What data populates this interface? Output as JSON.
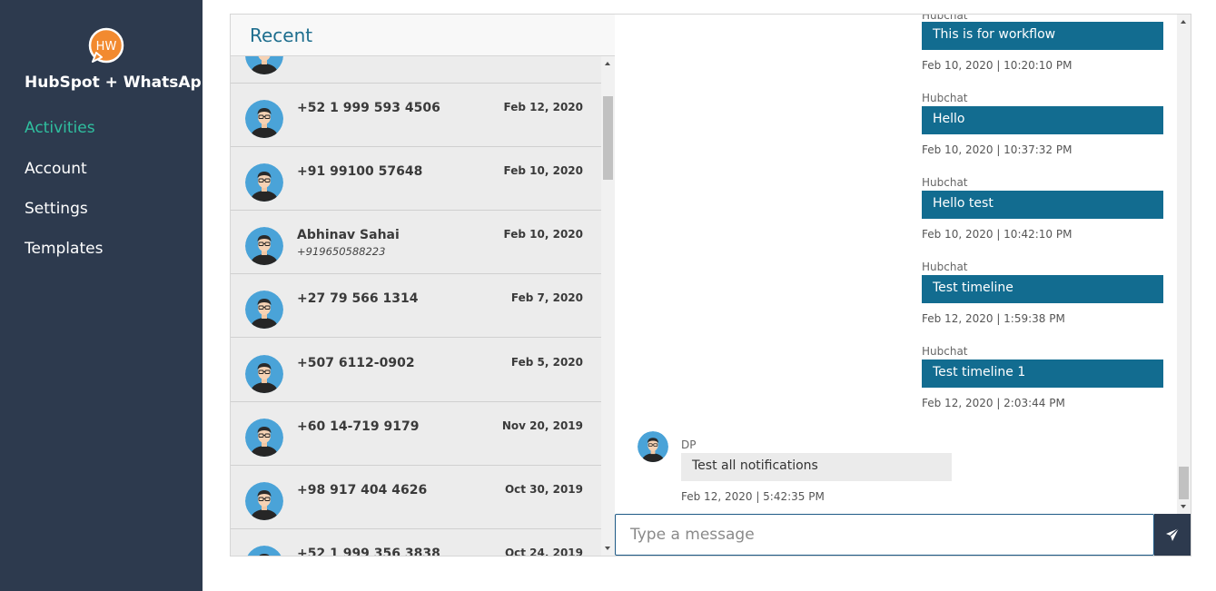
{
  "brand": {
    "logo_text": "HW",
    "name": "HubSpot + WhatsApp",
    "accent": "#2fbf9f",
    "logo_color": "#f28a30"
  },
  "nav": [
    {
      "label": "Activities",
      "active": true
    },
    {
      "label": "Account",
      "active": false
    },
    {
      "label": "Settings",
      "active": false
    },
    {
      "label": "Templates",
      "active": false
    }
  ],
  "recent": {
    "title": "Recent",
    "contacts": [
      {
        "name": "+52 1 999 593 4506",
        "sub": "",
        "date": "Feb 12, 2020"
      },
      {
        "name": "+91 99100 57648",
        "sub": "",
        "date": "Feb 10, 2020"
      },
      {
        "name": "Abhinav Sahai",
        "sub": "+919650588223",
        "date": "Feb 10, 2020"
      },
      {
        "name": "+27 79 566 1314",
        "sub": "",
        "date": "Feb 7, 2020"
      },
      {
        "name": "+507 6112-0902",
        "sub": "",
        "date": "Feb 5, 2020"
      },
      {
        "name": "+60 14-719 9179",
        "sub": "",
        "date": "Nov 20, 2019"
      },
      {
        "name": "+98 917 404 4626",
        "sub": "",
        "date": "Oct 30, 2019"
      },
      {
        "name": "+52 1 999 356 3838",
        "sub": "",
        "date": "Oct 24, 2019"
      }
    ]
  },
  "chat": {
    "messages": [
      {
        "sender": "Hubchat",
        "text": "This is for workflow",
        "time": "Feb 10, 2020 | 10:20:10 PM"
      },
      {
        "sender": "Hubchat",
        "text": "Hello",
        "time": "Feb 10, 2020 | 10:37:32 PM"
      },
      {
        "sender": "Hubchat",
        "text": "Hello test",
        "time": "Feb 10, 2020 | 10:42:10 PM"
      },
      {
        "sender": "Hubchat",
        "text": "Test timeline",
        "time": "Feb 12, 2020 | 1:59:38 PM"
      },
      {
        "sender": "Hubchat",
        "text": "Test timeline 1",
        "time": "Feb 12, 2020 | 2:03:44 PM"
      }
    ],
    "incoming": {
      "sender": "DP",
      "text": "Test all notifications",
      "time": "Feb 12, 2020 | 5:42:35 PM"
    },
    "input_placeholder": "Type a message",
    "send_icon": "paper-plane-icon",
    "bubble_color": "#126c90"
  }
}
